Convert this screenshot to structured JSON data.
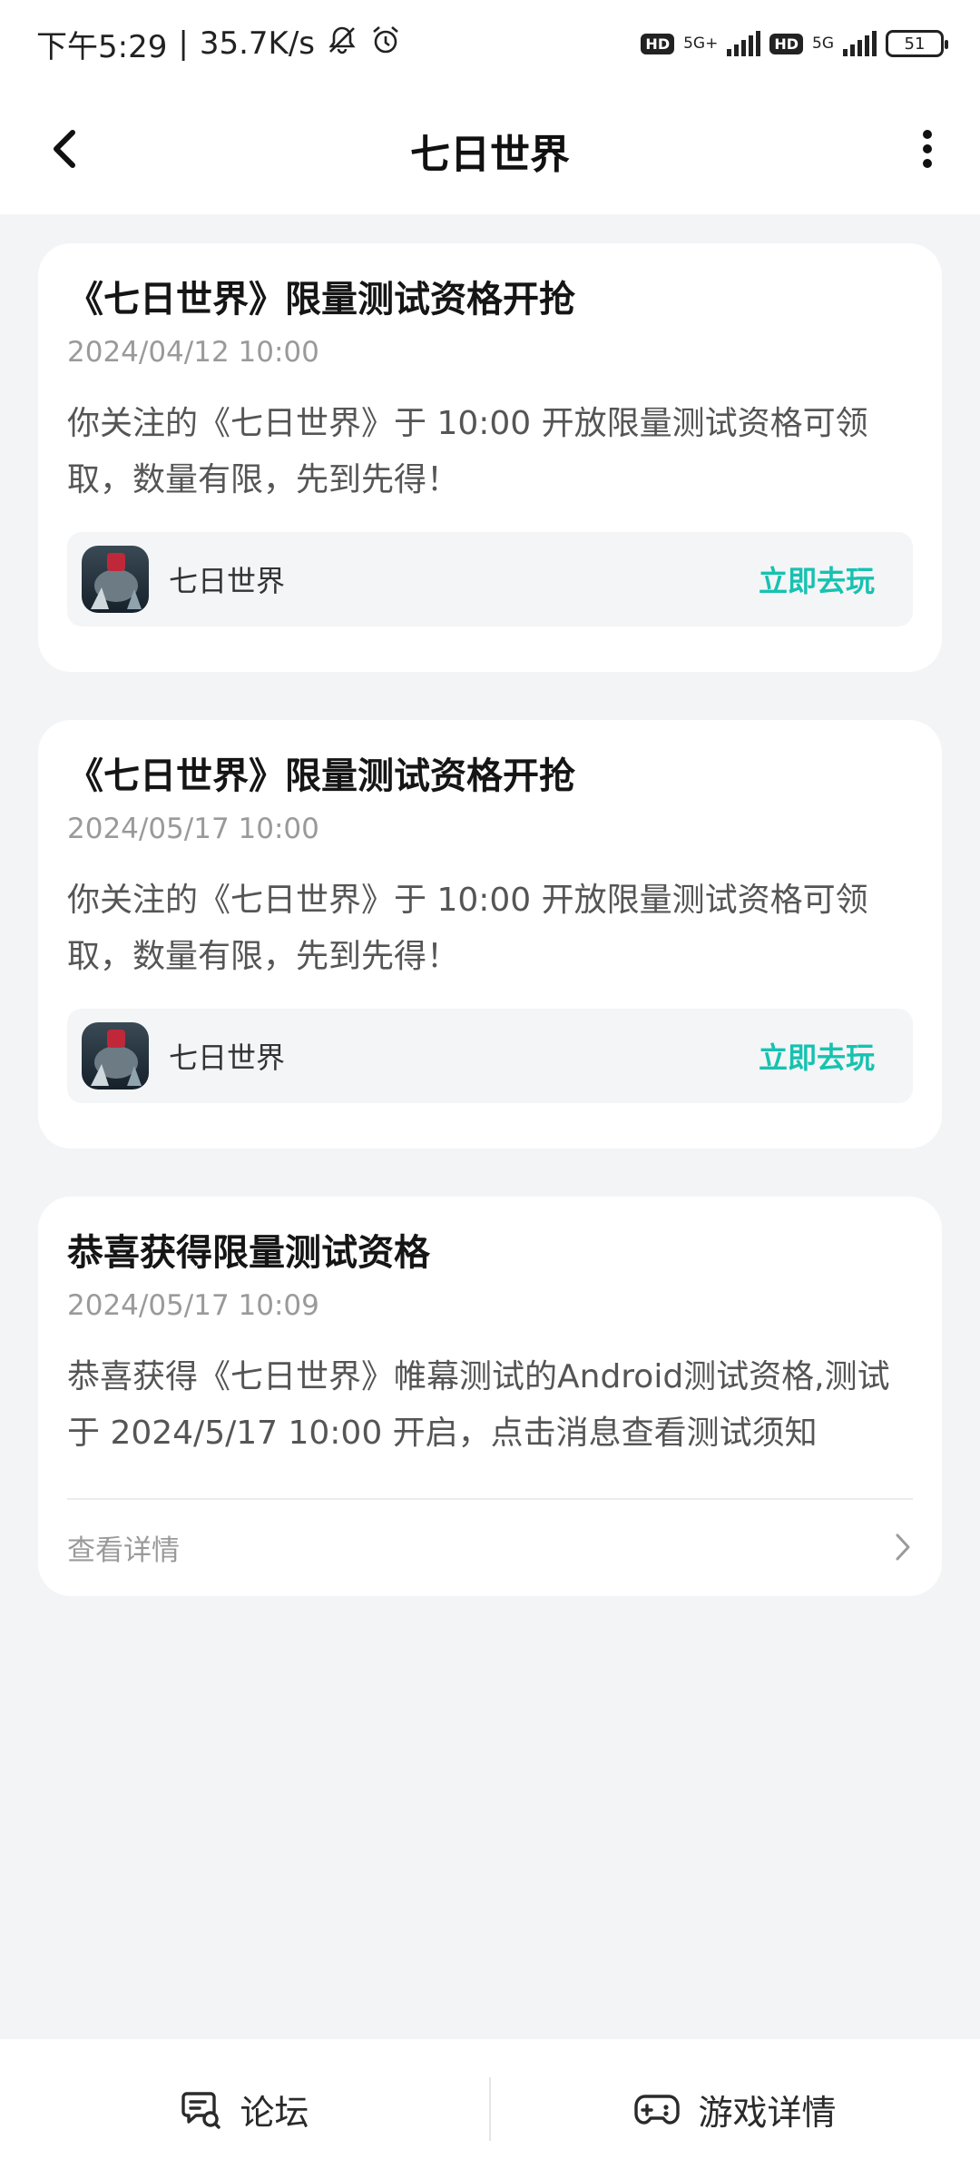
{
  "status_bar": {
    "time": "下午5:29",
    "separator": "|",
    "speed": "35.7K/s",
    "net1": "5G+",
    "net2": "5G",
    "hd": "HD",
    "battery": "51",
    "icons": [
      "bell-off-icon",
      "alarm-icon",
      "signal-icon",
      "battery-icon"
    ]
  },
  "header": {
    "title": "七日世界"
  },
  "cards": [
    {
      "title": "《七日世界》限量测试资格开抢",
      "date": "2024/04/12 10:00",
      "body": "你关注的《七日世界》于 10:00 开放限量测试资格可领取，数量有限，先到先得！",
      "game_name": "七日世界",
      "action": "立即去玩"
    },
    {
      "title": "《七日世界》限量测试资格开抢",
      "date": "2024/05/17 10:00",
      "body": "你关注的《七日世界》于 10:00 开放限量测试资格可领取，数量有限，先到先得！",
      "game_name": "七日世界",
      "action": "立即去玩"
    },
    {
      "title": "恭喜获得限量测试资格",
      "date": "2024/05/17 10:09",
      "body": "恭喜获得《七日世界》帷幕测试的Android测试资格,测试于 2024/5/17 10:00 开启，点击消息查看测试须知",
      "detail": "查看详情"
    }
  ],
  "bottom_nav": {
    "forum": "论坛",
    "game_detail": "游戏详情"
  },
  "colors": {
    "accent": "#16c2b0",
    "background": "#f3f4f6"
  }
}
